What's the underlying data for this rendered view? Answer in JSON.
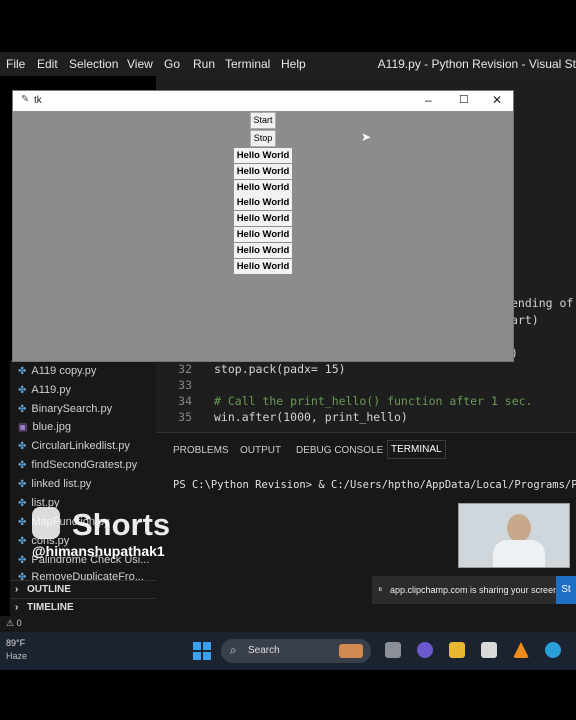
{
  "menubar": {
    "items": [
      "File",
      "Edit",
      "Selection",
      "View",
      "Go",
      "Run",
      "Terminal",
      "Help"
    ],
    "title": "A119.py - Python Revision - Visual St"
  },
  "editor": {
    "partial_right": [
      "ending of",
      "art)",
      ")"
    ],
    "lines": [
      {
        "num": "32",
        "code": "stop.pack(padx= 15)"
      },
      {
        "num": "33",
        "code": ""
      },
      {
        "num": "34",
        "code": "# Call the print_hello() function after 1 sec."
      },
      {
        "num": "35",
        "code": "win.after(1000, print_hello)"
      }
    ]
  },
  "explorer": {
    "files": [
      "A119 copy.py",
      "A119.py",
      "BinarySearch.py",
      "blue.jpg",
      "CircularLinkedlist.py",
      "findSecondGratest.py",
      "linked list.py",
      "list.py",
      "MapFunction.py",
      "cons.py",
      "Palindrome Check Usi...",
      "RemoveDuplicateFro..."
    ],
    "file_icons": [
      "py",
      "py",
      "py",
      "img",
      "py",
      "py",
      "py",
      "py",
      "py",
      "py",
      "py",
      "py"
    ],
    "outline": "OUTLINE",
    "timeline": "TIMELINE"
  },
  "panel": {
    "tabs": [
      "PROBLEMS",
      "OUTPUT",
      "DEBUG CONSOLE",
      "TERMINAL"
    ],
    "terminal_line": "PS C:\\Python Revision> & C:/Users/hptho/AppData/Local/Programs/P"
  },
  "tk": {
    "title": "tk",
    "start_label": "Start",
    "stop_label": "Stop",
    "hello_labels": [
      "Hello World",
      "Hello World",
      "Hello World",
      "Hello World",
      "Hello World",
      "Hello World",
      "Hello World",
      "Hello World"
    ]
  },
  "watermark": {
    "shorts": "Shorts",
    "handle": "@himanshupathak1"
  },
  "share": {
    "text": "app.clipchamp.com is sharing your screen.",
    "stop": "St"
  },
  "status": {
    "warnings": "⚠ 0"
  },
  "weather": {
    "temp": "89°F",
    "cond": "Haze"
  },
  "taskbar": {
    "search": "Search"
  }
}
